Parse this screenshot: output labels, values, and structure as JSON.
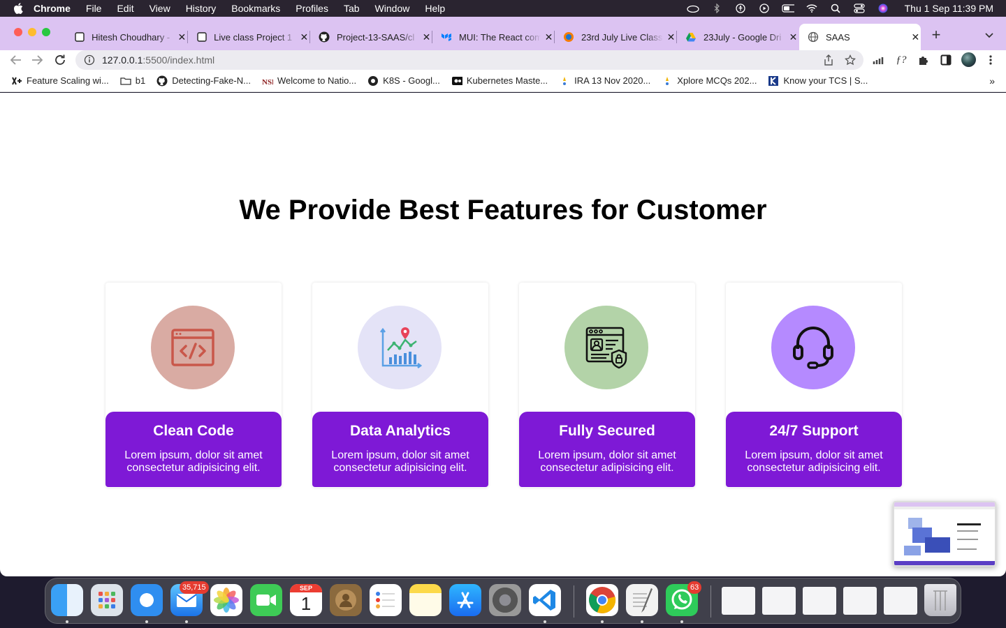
{
  "menubar": {
    "app_name": "Chrome",
    "items": [
      "File",
      "Edit",
      "View",
      "History",
      "Bookmarks",
      "Profiles",
      "Tab",
      "Window",
      "Help"
    ],
    "clock": "Thu 1 Sep  11:39 PM"
  },
  "tabs": [
    {
      "title": "Hitesh Choudhary -",
      "icon": "notion-icon"
    },
    {
      "title": "Live class Project 1",
      "icon": "notion-icon"
    },
    {
      "title": "Project-13-SAAS/cl",
      "icon": "github-icon"
    },
    {
      "title": "MUI: The React com",
      "icon": "mui-icon"
    },
    {
      "title": "23rd July Live Class",
      "icon": "ineuron-icon"
    },
    {
      "title": "23July - Google Dri",
      "icon": "google-drive-icon"
    },
    {
      "title": "SAAS",
      "icon": "globe-icon",
      "active": true
    }
  ],
  "address_bar": {
    "host": "127.0.0.1",
    "path": ":5500/index.html"
  },
  "bookmarks": [
    {
      "label": "Feature Scaling wi...",
      "icon": "site-icon"
    },
    {
      "label": "b1",
      "icon": "folder-icon"
    },
    {
      "label": "Detecting-Fake-N...",
      "icon": "github-icon"
    },
    {
      "label": "Welcome to Natio...",
      "icon": "nsr-icon"
    },
    {
      "label": "K8S - Googl...",
      "icon": "k8s-icon"
    },
    {
      "label": "Kubernetes Maste...",
      "icon": "video-icon"
    },
    {
      "label": "IRA 13 Nov 2020...",
      "icon": "tcs-icon"
    },
    {
      "label": "Xplore MCQs 202...",
      "icon": "tcs-icon"
    },
    {
      "label": "Know your TCS | S...",
      "icon": "k-icon"
    }
  ],
  "page": {
    "heading": "We Provide Best Features for Customer",
    "cards": [
      {
        "title": "Clean Code",
        "desc": "Lorem ipsum, dolor sit amet consectetur adipisicing elit.",
        "icon": "code-window-icon",
        "circle_color": "#d9aba3"
      },
      {
        "title": "Data Analytics",
        "desc": "Lorem ipsum, dolor sit amet consectetur adipisicing elit.",
        "icon": "analytics-chart-icon",
        "circle_color": "#e4e3f7"
      },
      {
        "title": "Fully Secured",
        "desc": "Lorem ipsum, dolor sit amet consectetur adipisicing elit.",
        "icon": "secure-profile-icon",
        "circle_color": "#b3d3a8"
      },
      {
        "title": "24/7 Support",
        "desc": "Lorem ipsum, dolor sit amet consectetur adipisicing elit.",
        "icon": "headset-icon",
        "circle_color": "#b58aff"
      }
    ],
    "accent_color": "#7e19d6"
  },
  "dock": {
    "mail_badge": "35,715",
    "whatsapp_badge": "63",
    "calendar_month": "SEP",
    "calendar_day": "1"
  }
}
